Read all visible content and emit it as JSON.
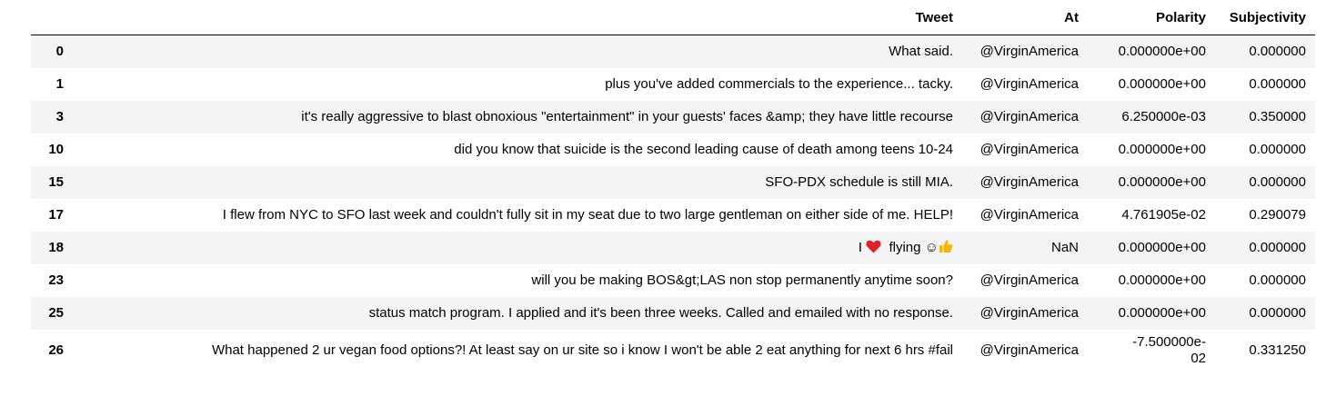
{
  "table": {
    "headers": [
      "Tweet",
      "At",
      "Polarity",
      "Subjectivity"
    ],
    "rows": [
      {
        "index": "0",
        "tweet": "What said.",
        "at": "@VirginAmerica",
        "polarity": "0.000000e+00",
        "subjectivity": "0.000000"
      },
      {
        "index": "1",
        "tweet": "plus you've added commercials to the experience... tacky.",
        "at": "@VirginAmerica",
        "polarity": "0.000000e+00",
        "subjectivity": "0.000000"
      },
      {
        "index": "3",
        "tweet": "it's really aggressive to blast obnoxious \"entertainment\" in your guests' faces &amp; they have little recourse",
        "at": "@VirginAmerica",
        "polarity": "6.250000e-03",
        "subjectivity": "0.350000"
      },
      {
        "index": "10",
        "tweet": "did you know that suicide is the second leading cause of death among teens 10-24",
        "at": "@VirginAmerica",
        "polarity": "0.000000e+00",
        "subjectivity": "0.000000"
      },
      {
        "index": "15",
        "tweet": "SFO-PDX schedule is still MIA.",
        "at": "@VirginAmerica",
        "polarity": "0.000000e+00",
        "subjectivity": "0.000000"
      },
      {
        "index": "17",
        "tweet": "I flew from NYC to SFO last week and couldn't fully sit in my seat due to two large gentleman on either side of me. HELP!",
        "at": "@VirginAmerica",
        "polarity": "4.761905e-02",
        "subjectivity": "0.290079"
      },
      {
        "index": "18",
        "tweet_prefix": "I",
        "tweet_suffix": "flying",
        "smile": "☺",
        "at": "NaN",
        "polarity": "0.000000e+00",
        "subjectivity": "0.000000"
      },
      {
        "index": "23",
        "tweet": "will you be making BOS&gt;LAS non stop permanently anytime soon?",
        "at": "@VirginAmerica",
        "polarity": "0.000000e+00",
        "subjectivity": "0.000000"
      },
      {
        "index": "25",
        "tweet": "status match program. I applied and it's been three weeks. Called and emailed with no response.",
        "at": "@VirginAmerica",
        "polarity": "0.000000e+00",
        "subjectivity": "0.000000"
      },
      {
        "index": "26",
        "tweet": "What happened 2 ur vegan food options?! At least say on ur site so i know I won't be able 2 eat anything for next 6 hrs #fail",
        "at": "@VirginAmerica",
        "polarity": "-7.500000e-02",
        "subjectivity": "0.331250"
      }
    ]
  },
  "icons": {
    "heart": "heart-icon",
    "thumbs_up": "thumbs-up-icon",
    "heart_color": "#e0202a",
    "thumb_color": "#f5b400"
  }
}
